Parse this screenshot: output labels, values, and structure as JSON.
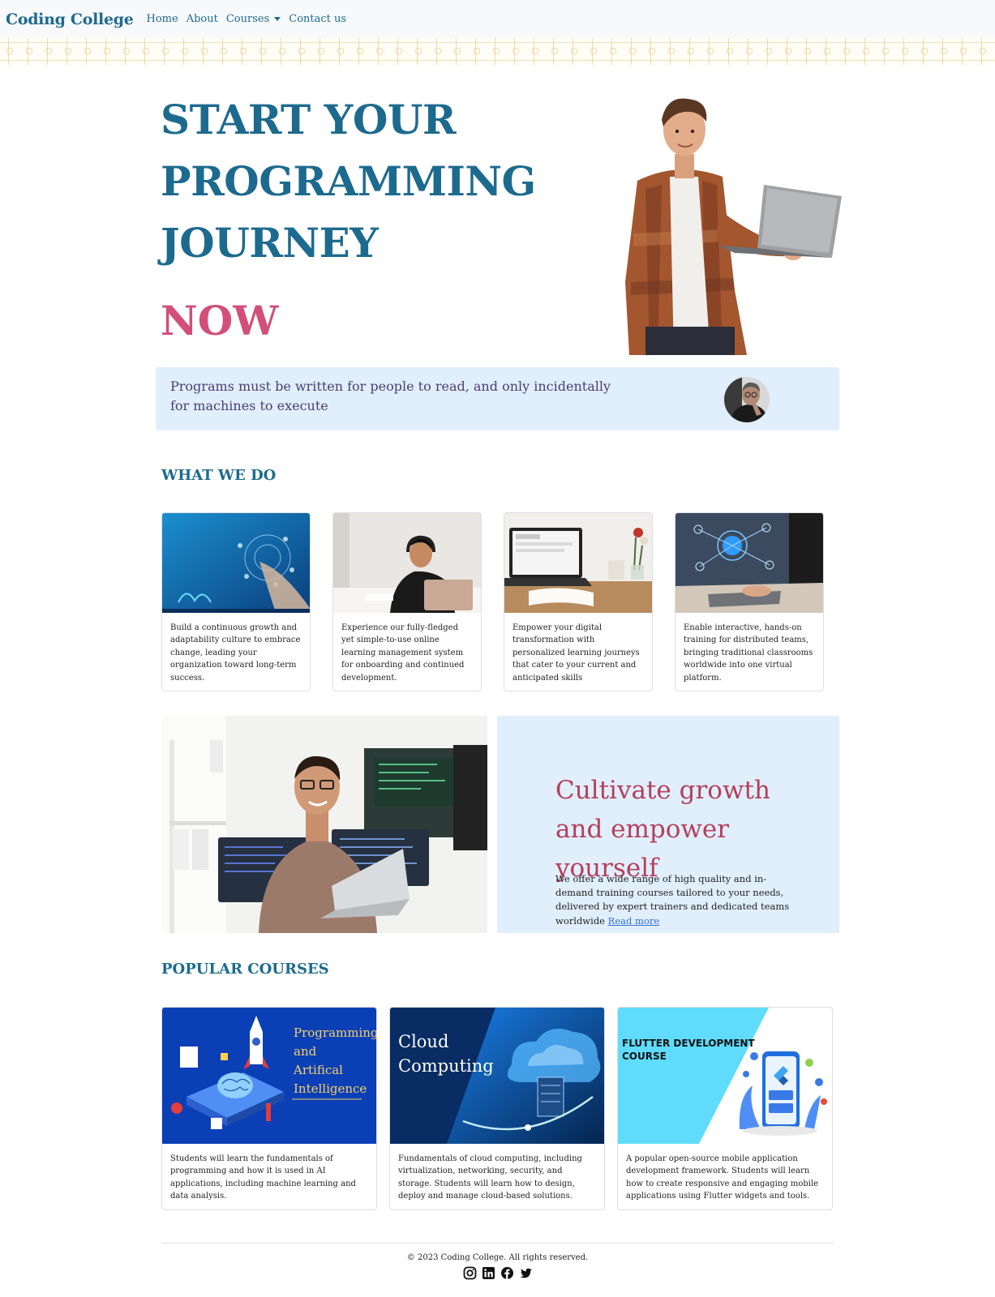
{
  "nav": {
    "brand": "Coding College",
    "links": [
      "Home",
      "About",
      "Courses",
      "Contact us"
    ]
  },
  "hero": {
    "line1": "START YOUR",
    "line2": "PROGRAMMING",
    "line3": "JOURNEY",
    "accent": "NOW"
  },
  "quote": {
    "text": "Programs must be written for people to read, and only incidentally for machines to execute"
  },
  "what_we_do": {
    "heading": "WHAT WE DO",
    "cards": [
      "Build a continuous growth and adaptability culture to embrace change, leading your organization toward long-term success.",
      "Experience our fully-fledged yet simple-to-use online learning management system for onboarding and continued development.",
      "Empower your digital transformation with personalized learning journeys that cater to your current and anticipated skills",
      "Enable interactive, hands-on training for distributed teams, bringing traditional classrooms worldwide into one virtual platform."
    ]
  },
  "feature": {
    "title": "Cultivate growth and empower yourself",
    "text": "We offer a wide range of high quality and in-demand training courses tailored to your needs, delivered by expert trainers and dedicated teams worldwide",
    "link": "Read more"
  },
  "popular": {
    "heading": "POPULAR COURSES",
    "cards": [
      {
        "image_lines": [
          "Programming",
          "and",
          "Artifical",
          "Intelligence"
        ],
        "text": "Students will learn the fundamentals of programming and how it is used in AI applications, including machine learning and data analysis."
      },
      {
        "image_lines": [
          "Cloud",
          "Computing"
        ],
        "text": "Fundamentals of cloud computing, including virtualization, networking, security, and storage. Students will learn how to design, deploy and manage cloud-based solutions."
      },
      {
        "image_lines": [
          "FLUTTER DEVELOPMENT",
          "COURSE"
        ],
        "text": "A popular open-source mobile application development framework. Students will learn how to create responsive and engaging mobile applications using Flutter widgets and tools."
      }
    ]
  },
  "footer": {
    "copyright": "© 2023 Coding College. All rights reserved.",
    "socials": [
      "instagram-icon",
      "linkedin-icon",
      "facebook-icon",
      "twitter-icon"
    ]
  },
  "colors": {
    "primary": "#1d6a8f",
    "accent_pink": "#d14f78",
    "feature_title": "#b3405a",
    "panel_bg": "#e1eefc"
  }
}
